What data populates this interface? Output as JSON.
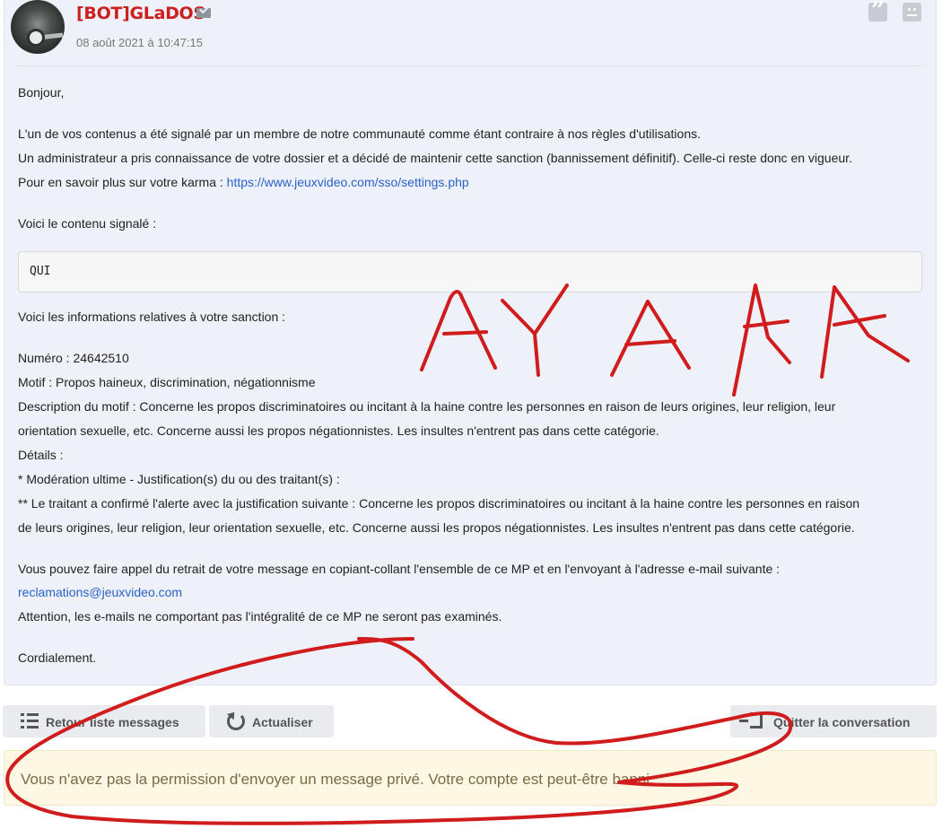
{
  "message": {
    "author": "[BOT]GLaDOS",
    "date": "08 août 2021 à 10:47:15",
    "greeting": "Bonjour,",
    "para1_line1": "L'un de vos contenus a été signalé par un membre de notre communauté comme étant contraire à nos règles d'utilisations.",
    "para1_line2": "Un administrateur a pris connaissance de votre dossier et a décidé de maintenir cette sanction (bannissement définitif). Celle-ci reste donc en vigueur.",
    "karma_prefix": "Pour en savoir plus sur votre karma : ",
    "karma_link": "https://www.jeuxvideo.com/sso/settings.php",
    "reported_intro": "Voici le contenu signalé :",
    "reported_content": "QUI",
    "sanction_intro": "Voici les informations relatives à votre sanction :",
    "number": "Numéro : 24642510",
    "motive": "Motif : Propos haineux, discrimination, négationnisme",
    "desc_line1": "Description du motif : Concerne les propos discriminatoires ou incitant à la haine contre les personnes en raison de leurs origines, leur religion, leur",
    "desc_line2": "orientation sexuelle, etc. Concerne aussi les propos négationnistes. Les insultes n'entrent pas dans cette catégorie.",
    "details": "Détails :",
    "detail1": "* Modération ultime - Justification(s) du ou des traitant(s) :",
    "detail2_line1": "** Le traitant a confirmé l'alerte avec la justification suivante : Concerne les propos discriminatoires ou incitant à la haine contre les personnes en raison",
    "detail2_line2": "de leurs origines, leur religion, leur orientation sexuelle, etc. Concerne aussi les propos négationnistes. Les insultes n'entrent pas dans cette catégorie.",
    "appeal_line1": "Vous pouvez faire appel du retrait de votre message en copiant-collant l'ensemble de ce MP et en l'envoyant à l'adresse e-mail suivante :",
    "appeal_email": "reclamations@jeuxvideo.com",
    "appeal_warning": "Attention, les e-mails ne comportant pas l'intégralité de ce MP ne seront pas examinés.",
    "closing": "Cordialement."
  },
  "actions": {
    "back_label": "Retour liste messages",
    "refresh_label": "Actualiser",
    "quit_label": "Quitter la conversation"
  },
  "alert": {
    "text": "Vous n'avez pas la permission d'envoyer un message privé. Votre compte est peut-être banni."
  },
  "annotation": {
    "handwritten_text": "AYAAA",
    "color": "#d01c1c"
  },
  "colors": {
    "author": "#cc1f1f",
    "link": "#2a62c9",
    "alert_bg": "#fcf8e3",
    "post_bg": "#eef1f7"
  }
}
